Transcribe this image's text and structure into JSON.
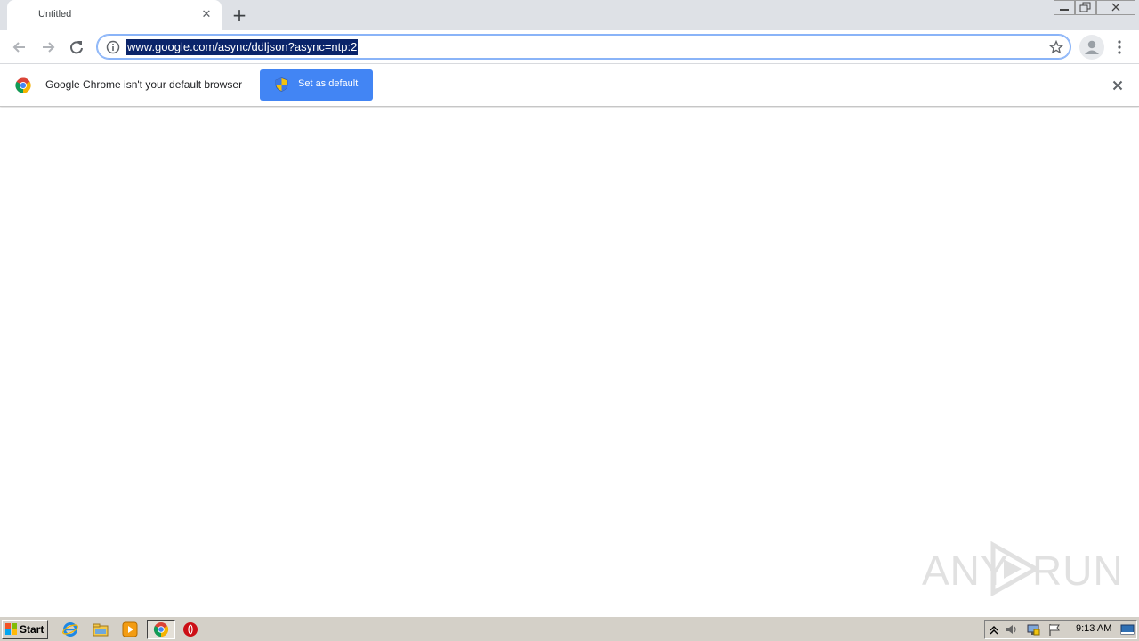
{
  "tabs": [
    {
      "title": "Untitled",
      "close_symbol": "✕"
    }
  ],
  "new_tab_symbol": "+",
  "window_controls": [
    "minimize-icon",
    "restore-icon",
    "close-icon"
  ],
  "toolbar": {
    "back": "arrow-left-icon",
    "forward": "arrow-right-icon",
    "reload": "reload-icon"
  },
  "omnibox": {
    "url": "www.google.com/async/ddljson?async=ntp:2",
    "selected": true
  },
  "infobar": {
    "message": "Google Chrome isn't your default browser",
    "button_label": "Set as default",
    "button_color": "#4285f4"
  },
  "watermark": {
    "left": "ANY",
    "right": "RUN"
  },
  "taskbar": {
    "start_label": "Start",
    "apps": [
      "internet-explorer-icon",
      "file-explorer-icon",
      "media-player-icon",
      "chrome-icon",
      "opera-icon"
    ],
    "clock": "9:13 AM"
  }
}
